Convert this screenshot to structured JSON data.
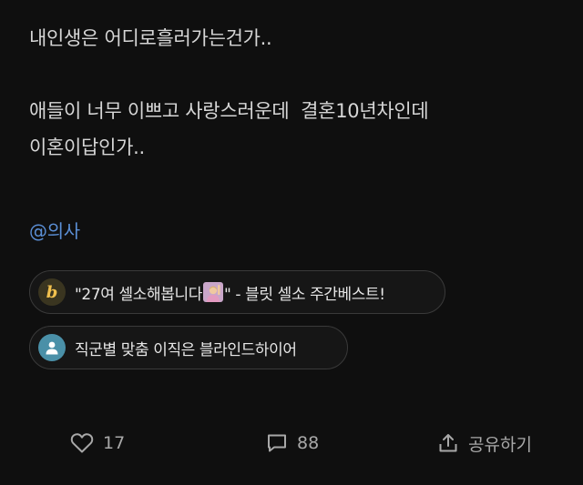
{
  "post": {
    "line1": "내인생은 어디로흘러가는건가..",
    "line2": "애들이 너무 이쁘고 사랑스러운데  결혼10년차인데",
    "line3": "이혼이답인가..",
    "mention": "@의사"
  },
  "chips": [
    {
      "icon": "blind-b-logo-icon",
      "text_before": "\"27여 셀소해봅니다",
      "emoji": "person-raising-hand-emoji",
      "text_after": "\" - 블릿 셀소 주간베스트!"
    },
    {
      "icon": "person-icon",
      "text": "직군별 맞춤 이직은 블라인드하이어"
    }
  ],
  "actions": {
    "like_count": "17",
    "comment_count": "88",
    "share_label": "공유하기"
  },
  "colors": {
    "background": "#0f0f0f",
    "mention": "#5b8fd6",
    "chip_border": "#3a3a3a",
    "logo_yellow": "#f2c14e"
  }
}
